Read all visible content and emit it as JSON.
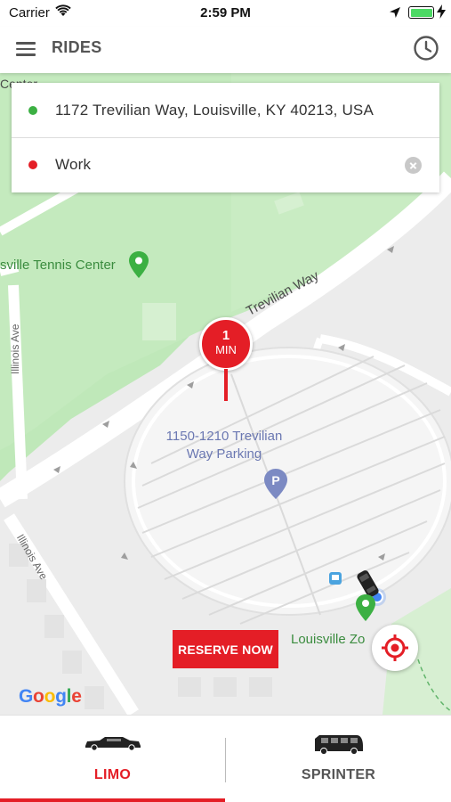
{
  "status_bar": {
    "carrier": "Carrier",
    "time": "2:59 PM"
  },
  "header": {
    "title": "RIDES",
    "menu_icon": "hamburger-menu-icon",
    "history_icon": "clock-icon"
  },
  "trip": {
    "pickup_address": "1172 Trevilian Way, Louisville, KY 40213, USA",
    "dropoff_address": "Work",
    "pickup_color": "#3cb043",
    "dropoff_color": "#e41e26"
  },
  "map": {
    "labels": {
      "center_partial": "Center",
      "tennis_center": "sville Tennis Center",
      "road_trevilian": "Trevilian Way",
      "illinois_ave_1": "Illinois Ave",
      "illinois_ave_2": "Illinois Ave",
      "parking_line1": "1150-1210 Trevilian",
      "parking_line2": "Way Parking",
      "zoo": "Louisville Zo"
    },
    "eta": {
      "number": "1",
      "unit": "MIN"
    },
    "reserve_button": "RESERVE NOW",
    "attribution": "Google"
  },
  "tabs": [
    {
      "label": "LIMO",
      "icon": "limousine-icon",
      "active": true
    },
    {
      "label": "SPRINTER",
      "icon": "sprinter-bus-icon",
      "active": false
    }
  ],
  "colors": {
    "accent": "#e41e26",
    "park_green": "#b7e3b1",
    "active_tab_text": "#e41e26",
    "inactive_tab_text": "#555555"
  }
}
